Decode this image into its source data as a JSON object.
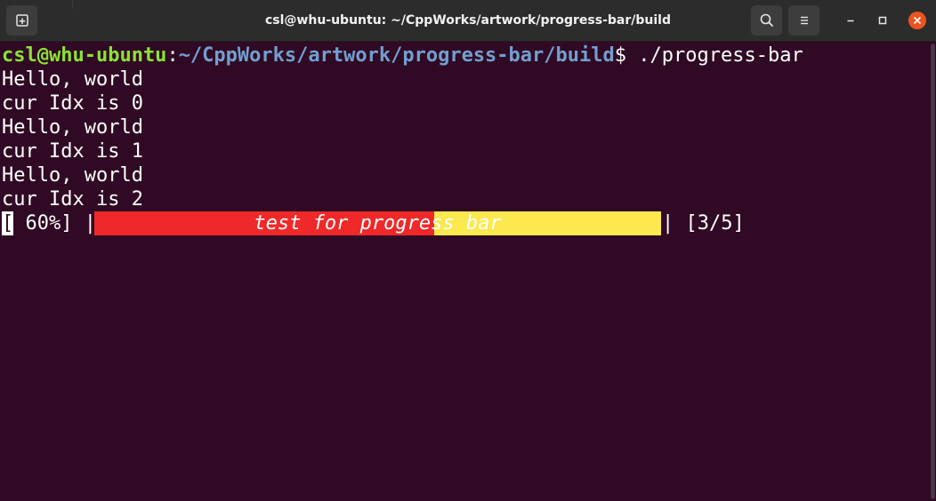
{
  "window": {
    "title": "csl@whu-ubuntu: ~/CppWorks/artwork/progress-bar/build",
    "buttons": {
      "new_tab_icon": "new-tab-icon",
      "search_icon": "search-icon",
      "menu_icon": "hamburger-menu-icon",
      "minimize_icon": "minimize-icon",
      "maximize_icon": "maximize-icon",
      "close_icon": "close-icon"
    },
    "colors": {
      "titlebar": "#2c2c2c",
      "terminal_bg": "#300a24",
      "close_button": "#e95420"
    }
  },
  "terminal": {
    "prompt": {
      "user_host": "csl@whu-ubuntu",
      "separator": ":",
      "path": "~/CppWorks/artwork/progress-bar/build",
      "symbol": "$",
      "command": " ./progress-bar"
    },
    "output": [
      "Hello, world",
      "cur Idx is 0",
      "Hello, world",
      "cur Idx is 1",
      "Hello, world",
      "cur Idx is 2"
    ],
    "progress": {
      "cursor_char": "[",
      "percent_text": " 60%] |",
      "bar_label": "test for progress bar",
      "fraction": 0.6,
      "end_text": "| [3/5]",
      "fill_color": "#ef2929",
      "remaining_color": "#fce94f"
    },
    "colors": {
      "user_host": "#8ae234",
      "path": "#729fcf",
      "text": "#ffffff"
    }
  }
}
